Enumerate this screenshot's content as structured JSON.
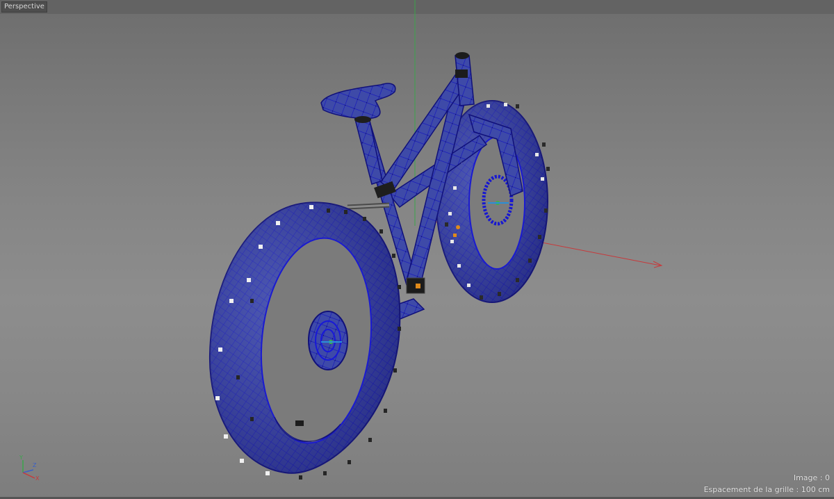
{
  "viewport": {
    "view_name": "Perspective",
    "frame_label": "Image : 0",
    "grid_spacing_label": "Espacement de la grille : 100 cm"
  },
  "scene": {
    "object": "fat bike wireframe model",
    "wire_color": "#1a1ad0",
    "mesh_fill": "#3a49a8",
    "axis_colors": {
      "x": "#c8383a",
      "y": "#3aa54a",
      "z": "#3a5fc8"
    }
  },
  "gizmo": {
    "labels": {
      "x": "X",
      "y": "Y",
      "z": "Z"
    }
  },
  "icons": [
    "world-axis-gizmo-icon"
  ]
}
